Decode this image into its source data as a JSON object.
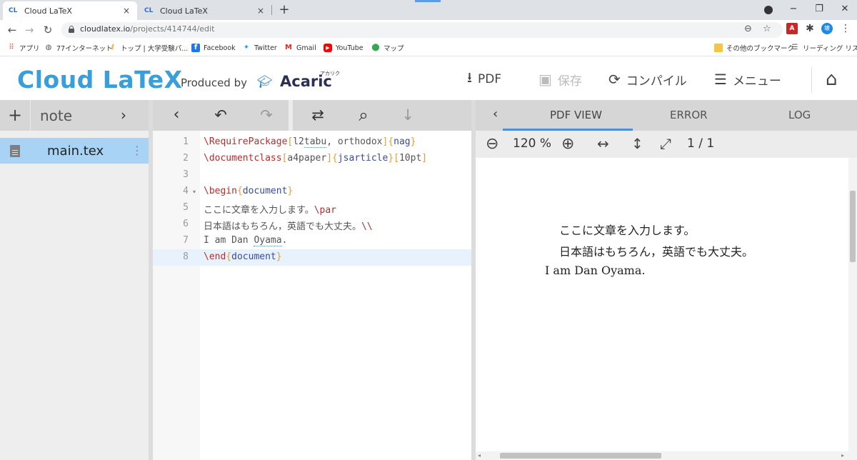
{
  "browser": {
    "tabs": [
      {
        "favicon": "CL",
        "title": "Cloud LaTeX",
        "close": "×"
      },
      {
        "favicon": "CL",
        "title": "Cloud LaTeX",
        "close": "×"
      }
    ],
    "new_tab": "+",
    "window_controls": {
      "minimize": "−",
      "maximize": "❐",
      "close": "✕"
    },
    "nav": {
      "back": "←",
      "forward": "→",
      "reload": "↻"
    },
    "url_host": "cloudlatex.io",
    "url_path": "/projects/414744/edit",
    "omni_icons": {
      "zoom": "⊖",
      "star": "☆"
    },
    "extensions": {
      "pdf": "A",
      "puzzle": "✱",
      "avatar": "壊",
      "more": "⋮"
    },
    "bookmarks": [
      {
        "icon": "apps-icon",
        "label": "アプリ"
      },
      {
        "icon": "globe-icon",
        "label": "77インターネット"
      },
      {
        "icon": "top-icon",
        "label": "トップ | 大学受験パ..."
      },
      {
        "icon": "facebook-icon",
        "label": "Facebook"
      },
      {
        "icon": "twitter-icon",
        "label": "Twitter"
      },
      {
        "icon": "gmail-icon",
        "label": "Gmail"
      },
      {
        "icon": "youtube-icon",
        "label": "YouTube"
      },
      {
        "icon": "maps-icon",
        "label": "マップ"
      },
      {
        "icon": "folder-icon",
        "label": "その他のブックマーク"
      },
      {
        "icon": "reading-list-icon",
        "label": "リーディング リスト"
      }
    ]
  },
  "app": {
    "logo": "Cloud LaTeX",
    "produced_by": "Produced by",
    "acaric": "Acaric",
    "acaric_kana": "アカリク",
    "header_buttons": {
      "pdf": "PDF",
      "save": "保存",
      "compile": "コンパイル",
      "menu": "メニュー"
    },
    "header_icons": {
      "pdf": "⭳",
      "save": "▣",
      "compile": "⟳",
      "menu": "☰",
      "home": "⌂"
    },
    "brand_color": "#3a9fd8"
  },
  "files": {
    "add": "+",
    "project": "note",
    "collapse": "›",
    "items": [
      {
        "name": "main.tex",
        "kebab": "⋮"
      }
    ]
  },
  "editor": {
    "toolbar": {
      "back": "‹",
      "undo": "↶",
      "redo": "↷",
      "replace": "⇄",
      "search": "⌕",
      "jump": "↓"
    },
    "line_numbers": [
      "1",
      "2",
      "3",
      "4",
      "5",
      "6",
      "7",
      "8"
    ],
    "fold_marker": "▾",
    "lines": {
      "l1": {
        "cmd": "\\RequirePackage",
        "b1": "[",
        "o1": "l2",
        "o1s": "tabu",
        "o2": ", orthodox",
        "b2": "]",
        "b3": "{",
        "arg": "nag",
        "b4": "}"
      },
      "l2": {
        "cmd": "\\documentclass",
        "b1": "[",
        "opt": "a4paper",
        "b2": "]",
        "b3": "{",
        "arg": "jsarticle",
        "b4": "}",
        "b5": "[",
        "opt2": "10pt",
        "b6": "]"
      },
      "l4": {
        "cmd": "\\begin",
        "b1": "{",
        "arg": "document",
        "b2": "}"
      },
      "l5": {
        "txt": "ここに文章を入力します。",
        "cmd": "\\par"
      },
      "l6": {
        "txt": "日本語はもちろん，英語でも大丈夫。",
        "cmd": "\\\\"
      },
      "l7": {
        "txt1": "I am Dan ",
        "spell": "Oyama",
        "txt2": "."
      },
      "l8": {
        "cmd": "\\end",
        "b1": "{",
        "arg": "document",
        "b2": "}"
      }
    }
  },
  "pdf": {
    "back": "‹",
    "tabs": {
      "view": "PDF VIEW",
      "error": "ERROR",
      "log": "LOG"
    },
    "toolbar": {
      "zoom_out": "⊖",
      "zoom": "120 %",
      "zoom_in": "⊕",
      "fit_width": "↔",
      "fit_height": "↕",
      "fullscreen": "⤢",
      "page": "1 / 1"
    },
    "content": [
      "ここに文章を入力します。",
      "日本語はもちろん，英語でも大丈夫。",
      "I am Dan Oyama."
    ],
    "scroll_arrows": {
      "left": "◂",
      "right": "▸"
    }
  }
}
